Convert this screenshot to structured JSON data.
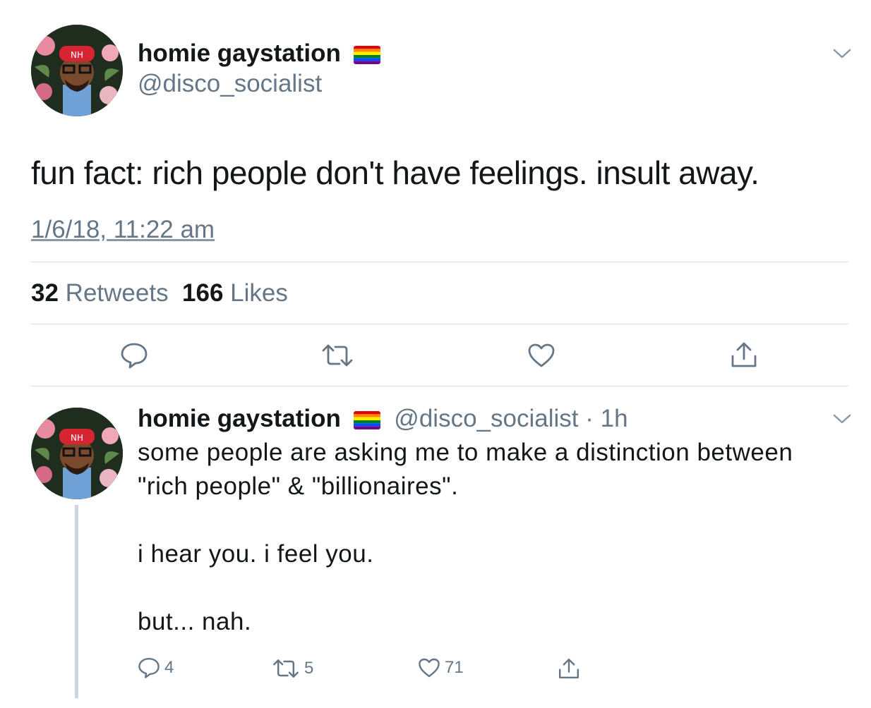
{
  "tweet": {
    "display_name": "homie gaystation",
    "flag_icon": "rainbow-flag-icon",
    "handle": "@disco_socialist",
    "text": "fun fact: rich people don't have feelings. insult away.",
    "timestamp": "1/6/18, 11:22 am",
    "retweets_count": "32",
    "retweets_label": "Retweets",
    "likes_count": "166",
    "likes_label": "Likes",
    "actions": [
      "reply-icon",
      "retweet-icon",
      "like-icon",
      "share-icon"
    ]
  },
  "reply": {
    "display_name": "homie gaystation",
    "flag_icon": "rainbow-flag-icon",
    "handle": "@disco_socialist",
    "separator": "·",
    "time": "1h",
    "lines": [
      "some people are asking me to make a distinction between",
      "\"rich people\" & \"billionaires\".",
      "",
      "i hear you. i feel you.",
      "",
      "but... nah."
    ],
    "reply_count": "4",
    "retweet_count": "5",
    "like_count": "71"
  },
  "colors": {
    "text": "#14171a",
    "secondary": "#657786",
    "divider": "#d9dfe4",
    "thread_line": "#ccd6dd"
  }
}
